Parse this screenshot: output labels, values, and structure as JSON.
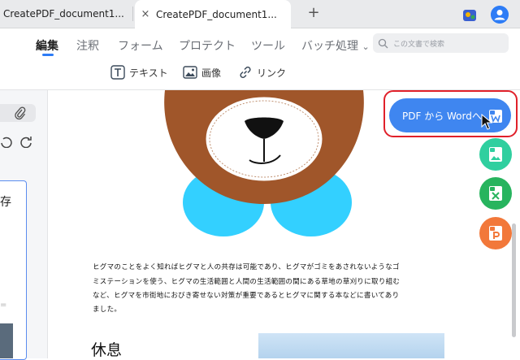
{
  "tabs": [
    {
      "label": "CreatePDF_document1...",
      "active": false
    },
    {
      "label": "CreatePDF_document1...",
      "active": true
    }
  ],
  "tab_close_icon": "×",
  "tab_add_icon": "+",
  "menu": [
    {
      "label": "編集",
      "active": true
    },
    {
      "label": "注釈",
      "active": false
    },
    {
      "label": "フォーム",
      "active": false
    },
    {
      "label": "プロテクト",
      "active": false
    },
    {
      "label": "ツール",
      "active": false
    },
    {
      "label": "バッチ処理",
      "active": false
    }
  ],
  "menu_caret": "⌄",
  "search": {
    "placeholder": "この文書で検索"
  },
  "subtools": [
    {
      "label": "テキスト",
      "icon": "text-box-icon"
    },
    {
      "label": "画像",
      "icon": "image-icon"
    },
    {
      "label": "リンク",
      "icon": "link-icon"
    }
  ],
  "left_panel": {
    "thumb_text": "存",
    "thumb_mark": "="
  },
  "document": {
    "paragraph": [
      "ヒグマのことをよく知ればヒグマと人の共存は可能であり、ヒグマがゴミをあされないようなゴ",
      "ミステーションを使う、ヒグマの生活範囲と人間の生活範囲の間にある草地の草刈りに取り組む",
      "など、ヒグマを市街地におびき寄せない対策が重要であるとヒグマに関する本などに書いてあり",
      "ました。"
    ],
    "heading": "休息"
  },
  "actions": {
    "to_word": "PDF から Wordへ",
    "others": [
      "to-image",
      "to-excel",
      "to-powerpoint"
    ]
  },
  "colors": {
    "accent": "#2d7cf6",
    "highlight": "#e0202a",
    "bear": "#a0562a",
    "bow": "#33d0ff"
  }
}
